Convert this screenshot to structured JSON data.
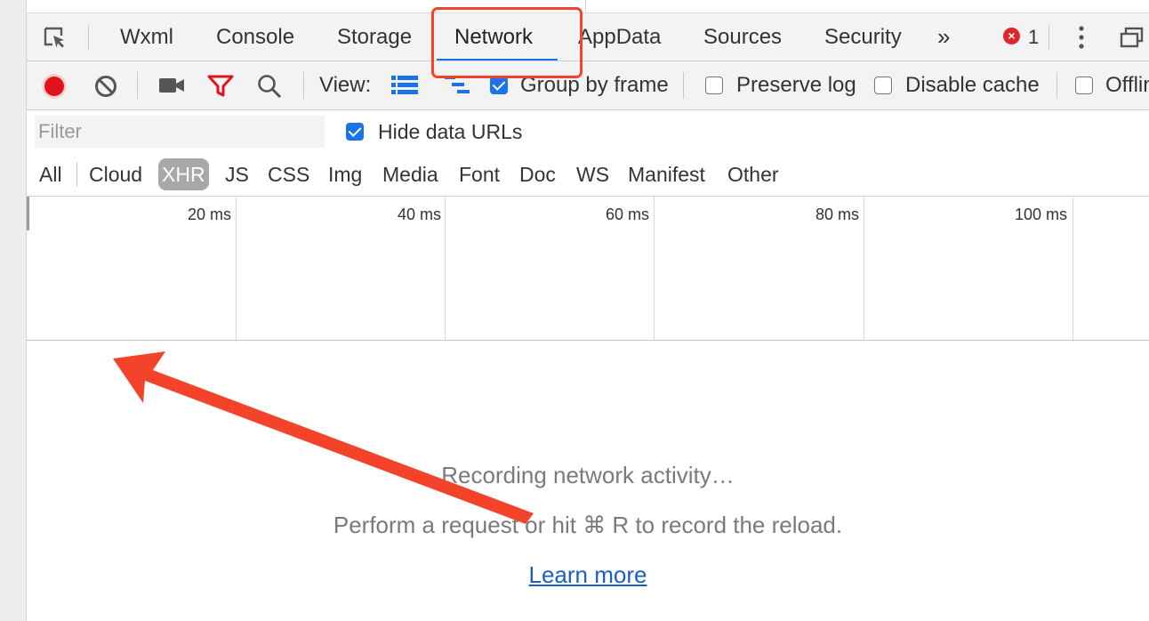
{
  "tabs": [
    {
      "label": "Wxml"
    },
    {
      "label": "Console"
    },
    {
      "label": "Storage"
    },
    {
      "label": "Network"
    },
    {
      "label": "AppData"
    },
    {
      "label": "Sources"
    },
    {
      "label": "Security"
    }
  ],
  "more_tabs_glyph": "»",
  "error_count": "1",
  "toolbar": {
    "view_label": "View:",
    "group_by_frame": "Group by frame",
    "preserve_log": "Preserve log",
    "disable_cache": "Disable cache",
    "offline": "Offlin"
  },
  "filter": {
    "placeholder": "Filter",
    "hide_data_urls": "Hide data URLs"
  },
  "types": [
    "All",
    "Cloud",
    "XHR",
    "JS",
    "CSS",
    "Img",
    "Media",
    "Font",
    "Doc",
    "WS",
    "Manifest",
    "Other"
  ],
  "timeline_ticks": [
    "20 ms",
    "40 ms",
    "60 ms",
    "80 ms",
    "100 ms"
  ],
  "empty_state": {
    "recording": "Recording network activity…",
    "hint": "Perform a request or hit ⌘ R to record the reload.",
    "learn_more": "Learn more"
  },
  "colors": {
    "accent": "#1a73e8",
    "record_red": "#e0131b",
    "highlight": "#f4432b"
  }
}
